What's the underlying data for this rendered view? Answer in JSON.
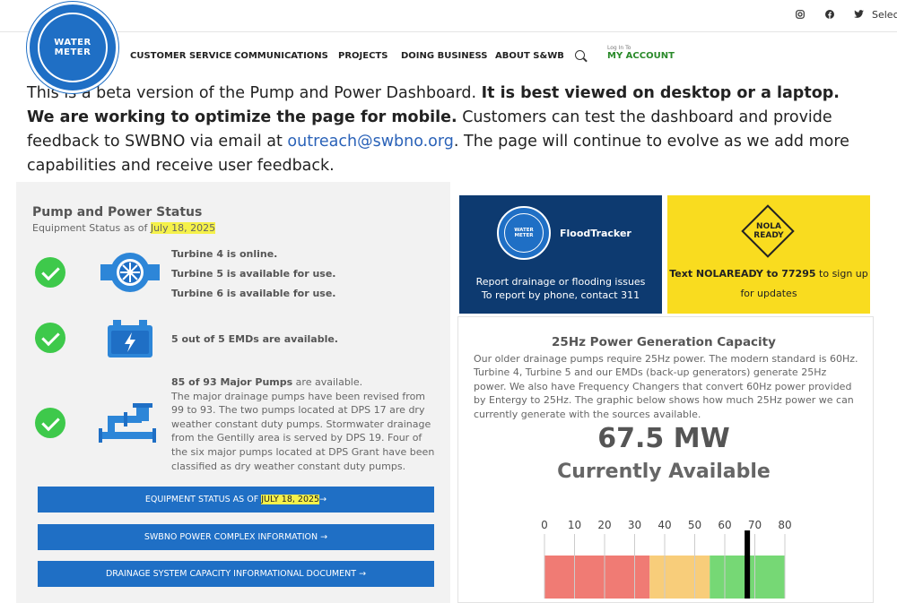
{
  "topbar": {
    "social": [
      "instagram-icon",
      "facebook-icon",
      "twitter-icon"
    ],
    "language_select": "Selec"
  },
  "logo": {
    "text": "WATER METER",
    "alt": "Sewerage & Water Board New Orleans"
  },
  "nav": {
    "items": [
      "CUSTOMER SERVICE",
      "COMMUNICATIONS",
      "PROJECTS",
      "DOING BUSINESS",
      "ABOUT S&WB"
    ],
    "login_small": "Log In To",
    "account": "MY ACCOUNT"
  },
  "intro": {
    "part1": "This is a beta version of the Pump and Power Dashboard. ",
    "bold": "It is best viewed on desktop or a laptop. We are working to optimize the page for mobile.",
    "part2": " Customers can test the dashboard and provide feedback to SWBNO via email at ",
    "email": "outreach@swbno.org",
    "part3": ". The page will continue to evolve as we add more capabilities and receive user feedback."
  },
  "status": {
    "title": "Pump and Power Status",
    "subtitle_prefix": "Equipment Status as of ",
    "date": "July 18, 2025",
    "turbines": [
      "Turbine 4 is online.",
      "Turbine 5 is available for use.",
      "Turbine 6 is available for use."
    ],
    "emds": "5 out of 5 EMDs are available.",
    "pumps_bold": "85 of 93 Major Pumps",
    "pumps_rest": " are available.",
    "pumps_desc": "The major drainage pumps have been revised from 99 to 93. The two pumps located at DPS 17 are dry weather constant duty pumps. Stormwater drainage from the Gentilly area is served by DPS 19. Four of the six major pumps located at DPS Grant have been classified as dry weather constant duty pumps."
  },
  "buttons": {
    "equipment_prefix": "EQUIPMENT STATUS AS OF ",
    "equipment_date": "JULY 18, 2025",
    "arrow": "→",
    "power_complex": "SWBNO POWER COMPLEX INFORMATION",
    "drainage_doc": "DRAINAGE SYSTEM CAPACITY INFORMATIONAL DOCUMENT"
  },
  "floodtracker": {
    "title": "FloodTracker",
    "line1": "Report drainage or flooding issues",
    "line2": "To report by phone, contact 311",
    "logo_text": "WATER METER"
  },
  "nolaready": {
    "logo_line1": "NOLA",
    "logo_line2": "READY",
    "cta_bold": "Text NOLAREADY to 77295",
    "cta_rest": " to sign up for updates"
  },
  "capacity": {
    "title": "25Hz Power Generation Capacity",
    "description": "Our older drainage pumps require 25Hz power. The modern standard is 60Hz. Turbine 4, Turbine 5 and our EMDs (back-up generators) generate 25Hz power. We also have Frequency Changers that convert 60Hz power provided by Entergy to 25Hz. The graphic below shows how much 25Hz power we can currently generate with the sources available.",
    "value": "67.5 MW",
    "label": "Currently Available",
    "gauge": {
      "min": 0,
      "max": 80,
      "ticks": [
        0,
        10,
        20,
        30,
        40,
        50,
        60,
        70,
        80
      ],
      "current": 67.5,
      "bands": [
        {
          "from": 0,
          "to": 35,
          "color": "#f07b74"
        },
        {
          "from": 35,
          "to": 55,
          "color": "#f8cd7a"
        },
        {
          "from": 55,
          "to": 80,
          "color": "#76d875"
        }
      ]
    }
  },
  "colors": {
    "brand_blue": "#1f6fc5",
    "navy": "#0d3a70",
    "yellow": "#f9dc1f",
    "green_check": "#3ec94b",
    "highlight": "#f5f14a"
  }
}
